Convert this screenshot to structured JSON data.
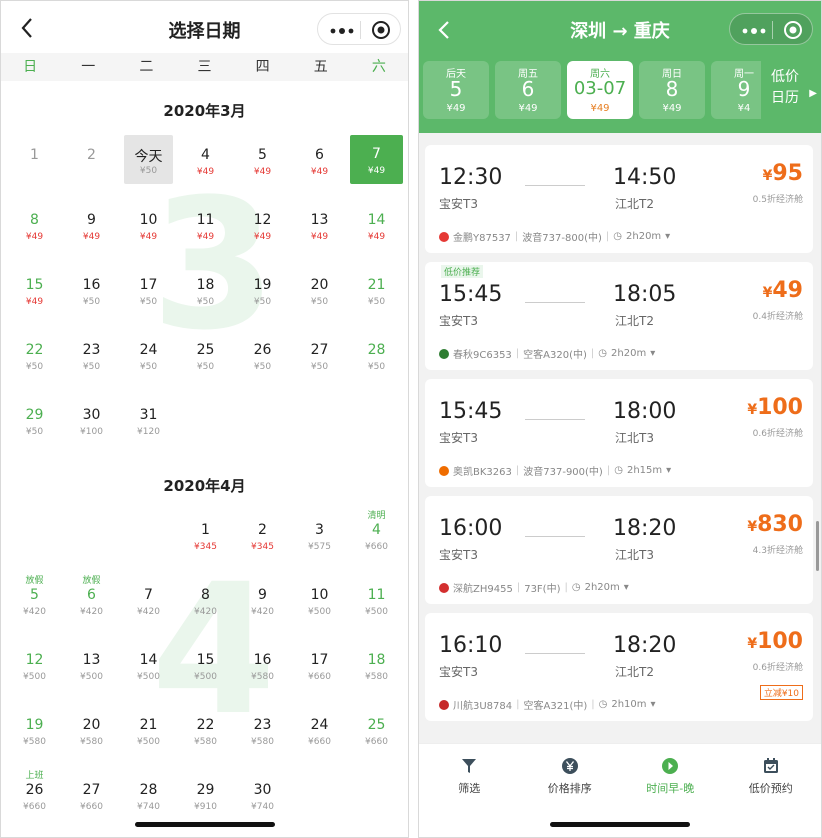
{
  "left": {
    "title": "选择日期",
    "weekdays": [
      "日",
      "一",
      "二",
      "三",
      "四",
      "五",
      "六"
    ],
    "march": {
      "title": "2020年3月",
      "cells": [
        {
          "day": "1",
          "price": "",
          "past": true
        },
        {
          "day": "2",
          "price": "",
          "past": true
        },
        {
          "day": "今天",
          "price": "¥50",
          "today": true
        },
        {
          "day": "4",
          "price": "¥49",
          "low": true
        },
        {
          "day": "5",
          "price": "¥49",
          "low": true
        },
        {
          "day": "6",
          "price": "¥49",
          "low": true
        },
        {
          "day": "7",
          "price": "¥49",
          "sel": true
        },
        {
          "day": "8",
          "price": "¥49",
          "low": true,
          "we": true
        },
        {
          "day": "9",
          "price": "¥49",
          "low": true
        },
        {
          "day": "10",
          "price": "¥49",
          "low": true
        },
        {
          "day": "11",
          "price": "¥49",
          "low": true
        },
        {
          "day": "12",
          "price": "¥49",
          "low": true
        },
        {
          "day": "13",
          "price": "¥49",
          "low": true
        },
        {
          "day": "14",
          "price": "¥49",
          "low": true,
          "we": true
        },
        {
          "day": "15",
          "price": "¥49",
          "low": true,
          "we": true
        },
        {
          "day": "16",
          "price": "¥50"
        },
        {
          "day": "17",
          "price": "¥50"
        },
        {
          "day": "18",
          "price": "¥50"
        },
        {
          "day": "19",
          "price": "¥50"
        },
        {
          "day": "20",
          "price": "¥50"
        },
        {
          "day": "21",
          "price": "¥50",
          "we": true
        },
        {
          "day": "22",
          "price": "¥50",
          "we": true
        },
        {
          "day": "23",
          "price": "¥50"
        },
        {
          "day": "24",
          "price": "¥50"
        },
        {
          "day": "25",
          "price": "¥50"
        },
        {
          "day": "26",
          "price": "¥50"
        },
        {
          "day": "27",
          "price": "¥50"
        },
        {
          "day": "28",
          "price": "¥50",
          "we": true
        },
        {
          "day": "29",
          "price": "¥50",
          "we": true
        },
        {
          "day": "30",
          "price": "¥100"
        },
        {
          "day": "31",
          "price": "¥120"
        }
      ]
    },
    "april": {
      "title": "2020年4月",
      "cells": [
        {
          "blank": true
        },
        {
          "blank": true
        },
        {
          "blank": true
        },
        {
          "day": "1",
          "price": "¥345",
          "low": true
        },
        {
          "day": "2",
          "price": "¥345",
          "low": true
        },
        {
          "day": "3",
          "price": "¥575"
        },
        {
          "day": "4",
          "price": "¥660",
          "we": true,
          "hol": "清明"
        },
        {
          "day": "5",
          "price": "¥420",
          "we": true,
          "hol": "放假"
        },
        {
          "day": "6",
          "price": "¥420",
          "we": true,
          "hol": "放假"
        },
        {
          "day": "7",
          "price": "¥420"
        },
        {
          "day": "8",
          "price": "¥420"
        },
        {
          "day": "9",
          "price": "¥420"
        },
        {
          "day": "10",
          "price": "¥500"
        },
        {
          "day": "11",
          "price": "¥500",
          "we": true
        },
        {
          "day": "12",
          "price": "¥500",
          "we": true
        },
        {
          "day": "13",
          "price": "¥500"
        },
        {
          "day": "14",
          "price": "¥500"
        },
        {
          "day": "15",
          "price": "¥500"
        },
        {
          "day": "16",
          "price": "¥580"
        },
        {
          "day": "17",
          "price": "¥660"
        },
        {
          "day": "18",
          "price": "¥580",
          "we": true
        },
        {
          "day": "19",
          "price": "¥580",
          "we": true
        },
        {
          "day": "20",
          "price": "¥580"
        },
        {
          "day": "21",
          "price": "¥500"
        },
        {
          "day": "22",
          "price": "¥580"
        },
        {
          "day": "23",
          "price": "¥580"
        },
        {
          "day": "24",
          "price": "¥660"
        },
        {
          "day": "25",
          "price": "¥660",
          "we": true
        },
        {
          "day": "26",
          "price": "¥660",
          "hol": "上班"
        },
        {
          "day": "27",
          "price": "¥660"
        },
        {
          "day": "28",
          "price": "¥740"
        },
        {
          "day": "29",
          "price": "¥910"
        },
        {
          "day": "30",
          "price": "¥740"
        }
      ]
    },
    "watermark_march": "3",
    "watermark_april": "4"
  },
  "right": {
    "title": "深圳 → 重庆",
    "dates": [
      {
        "week": "后天",
        "day": "5",
        "price": "¥49"
      },
      {
        "week": "周五",
        "day": "6",
        "price": "¥49"
      },
      {
        "week": "周六",
        "day": "03-07",
        "price": "¥49",
        "active": true
      },
      {
        "week": "周日",
        "day": "8",
        "price": "¥49"
      },
      {
        "week": "周一",
        "day": "9",
        "price": "¥4"
      }
    ],
    "low_calendar": [
      "低价",
      "日历"
    ],
    "flights": [
      {
        "tag": "",
        "dep": "12:30",
        "arr": "14:50",
        "dep_apt": "宝安T3",
        "arr_apt": "江北T2",
        "price": "95",
        "disc": "0.5折经济舱",
        "airline": "金鹏Y87537",
        "plane": "波音737-800(中)",
        "dur": "2h20m",
        "promo": "",
        "color": "#e53935"
      },
      {
        "tag": "低价推荐",
        "dep": "15:45",
        "arr": "18:05",
        "dep_apt": "宝安T3",
        "arr_apt": "江北T2",
        "price": "49",
        "disc": "0.4折经济舱",
        "airline": "春秋9C6353",
        "plane": "空客A320(中)",
        "dur": "2h20m",
        "promo": "",
        "color": "#2e7d32"
      },
      {
        "tag": "",
        "dep": "15:45",
        "arr": "18:00",
        "dep_apt": "宝安T3",
        "arr_apt": "江北T3",
        "price": "100",
        "disc": "0.6折经济舱",
        "airline": "奥凯BK3263",
        "plane": "波音737-900(中)",
        "dur": "2h15m",
        "promo": "",
        "color": "#ef6c00"
      },
      {
        "tag": "",
        "dep": "16:00",
        "arr": "18:20",
        "dep_apt": "宝安T3",
        "arr_apt": "江北T3",
        "price": "830",
        "disc": "4.3折经济舱",
        "airline": "深航ZH9455",
        "plane": "73F(中)",
        "dur": "2h20m",
        "promo": "",
        "color": "#d32f2f"
      },
      {
        "tag": "",
        "dep": "16:10",
        "arr": "18:20",
        "dep_apt": "宝安T3",
        "arr_apt": "江北T2",
        "price": "100",
        "disc": "0.6折经济舱",
        "airline": "川航3U8784",
        "plane": "空客A321(中)",
        "dur": "2h10m",
        "promo": "立减¥10",
        "color": "#c62828"
      }
    ],
    "tabs": [
      {
        "label": "筛选",
        "icon": "filter-icon"
      },
      {
        "label": "价格排序",
        "icon": "yen-icon"
      },
      {
        "label": "时间早-晚",
        "icon": "clock-icon",
        "active": true
      },
      {
        "label": "低价预约",
        "icon": "calendar-icon"
      }
    ]
  },
  "colors": {
    "accent": "#4caf50",
    "price": "#ee6d1a",
    "low": "#e53935"
  }
}
